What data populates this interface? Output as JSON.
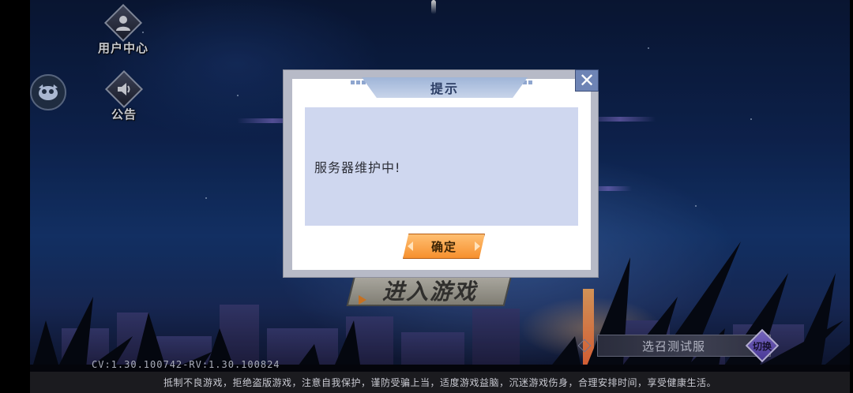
{
  "hud": {
    "user_center_label": "用户中心",
    "notice_label": "公告"
  },
  "main": {
    "enter_game_label": "进入游戏"
  },
  "server": {
    "name": "选召测试服",
    "switch_label": "切换"
  },
  "version_text": "CV:1.30.100742-RV:1.30.100824",
  "health_notice": "抵制不良游戏，拒绝盗版游戏，注意自我保护，谨防受骗上当，适度游戏益脑，沉迷游戏伤身，合理安排时间，享受健康生活。",
  "dialog": {
    "title": "提示",
    "close_symbol": "✕",
    "message": "服务器维护中!",
    "confirm_label": "确定"
  },
  "colors": {
    "dialog_frame": "#b7bac7",
    "message_bg": "#cfd7ef",
    "confirm_button": "#f6902e",
    "close_button": "#6e84b5"
  }
}
